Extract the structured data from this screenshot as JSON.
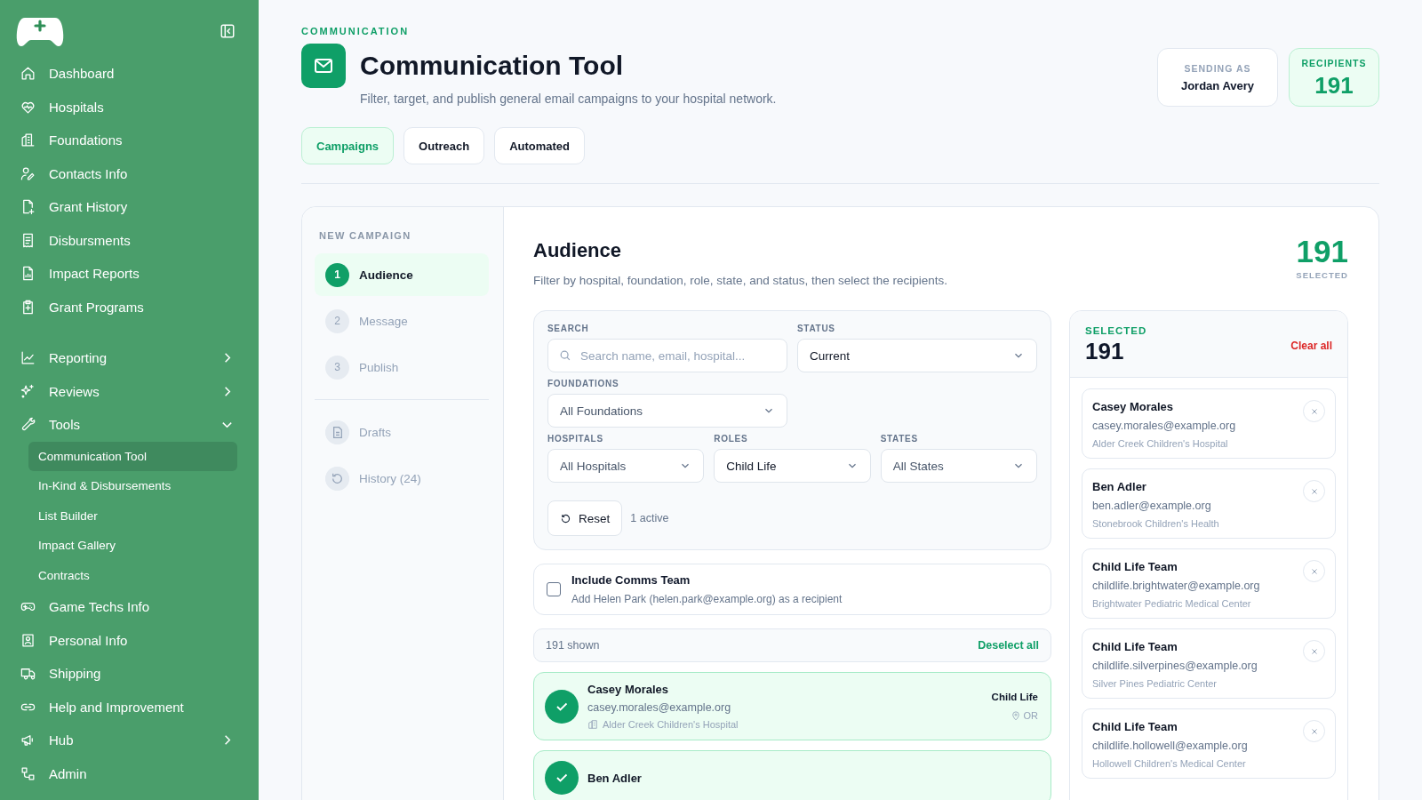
{
  "sidebar": {
    "sections": [
      {
        "items": [
          {
            "label": "Dashboard"
          },
          {
            "label": "Hospitals"
          },
          {
            "label": "Foundations"
          },
          {
            "label": "Contacts Info"
          },
          {
            "label": "Grant History"
          },
          {
            "label": "Disbursments"
          },
          {
            "label": "Impact Reports"
          },
          {
            "label": "Grant Programs"
          }
        ]
      },
      {
        "items": [
          {
            "label": "Reporting",
            "expanded": false
          },
          {
            "label": "Reviews",
            "expanded": false
          },
          {
            "label": "Tools",
            "expanded": true,
            "children": [
              {
                "label": "Communication Tool",
                "selected": true
              },
              {
                "label": "In-Kind & Disbursements",
                "selected": false
              },
              {
                "label": "List Builder",
                "selected": false
              },
              {
                "label": "Impact Gallery",
                "selected": false
              },
              {
                "label": "Contracts",
                "selected": false
              }
            ]
          },
          {
            "label": "Game Techs Info"
          },
          {
            "label": "Personal Info"
          },
          {
            "label": "Shipping"
          },
          {
            "label": "Help and Improvement"
          },
          {
            "label": "Hub",
            "expanded": false
          },
          {
            "label": "Admin"
          }
        ]
      }
    ]
  },
  "header": {
    "eyebrow": "COMMUNICATION",
    "title": "Communication Tool",
    "subtitle": "Filter, target, and publish general email campaigns to your hospital network.",
    "sending_as": {
      "label": "SENDING AS",
      "value": "Jordan Avery"
    },
    "recipients": {
      "label": "RECIPIENTS",
      "value": "191"
    }
  },
  "tabs": [
    {
      "label": "Campaigns",
      "selected": true
    },
    {
      "label": "Outreach",
      "selected": false
    },
    {
      "label": "Automated",
      "selected": false
    }
  ],
  "campaign_nav": {
    "title": "NEW CAMPAIGN",
    "steps": [
      {
        "number": "1",
        "label": "Audience",
        "selected": true
      },
      {
        "number": "2",
        "label": "Message",
        "selected": false
      },
      {
        "number": "3",
        "label": "Publish",
        "selected": false
      }
    ],
    "links": [
      {
        "label": "Drafts"
      },
      {
        "label": "History (24)"
      }
    ]
  },
  "audience": {
    "title": "Audience",
    "description": "Filter by hospital, foundation, role, state, and status, then select the recipients.",
    "count": "191",
    "count_label": "SELECTED",
    "filters": {
      "search": {
        "label": "SEARCH",
        "placeholder": "Search name, email, hospital..."
      },
      "status": {
        "label": "STATUS",
        "value": "Current"
      },
      "foundations": {
        "label": "FOUNDATIONS",
        "value": "All Foundations"
      },
      "hospitals": {
        "label": "HOSPITALS",
        "value": "All Hospitals"
      },
      "roles": {
        "label": "ROLES",
        "value": "Child Life"
      },
      "states": {
        "label": "STATES",
        "value": "All States"
      },
      "reset": "Reset",
      "active": "1 active"
    },
    "comms_team": {
      "checked": false,
      "title": "Include Comms Team",
      "description": "Add Helen Park (helen.park@example.org) as a recipient"
    },
    "list_bar": {
      "shown": "191 shown",
      "action": "Deselect all"
    },
    "rows": [
      {
        "name": "Casey Morales",
        "email": "casey.morales@example.org",
        "hospital": "Alder Creek Children's Hospital",
        "role": "Child Life",
        "state": "OR",
        "selected": true
      },
      {
        "name": "Ben Adler",
        "selected": true
      }
    ]
  },
  "selected_panel": {
    "label": "SELECTED",
    "count": "191",
    "clear": "Clear all",
    "items": [
      {
        "name": "Casey Morales",
        "email": "casey.morales@example.org",
        "hospital": "Alder Creek Children's Hospital"
      },
      {
        "name": "Ben Adler",
        "email": "ben.adler@example.org",
        "hospital": "Stonebrook Children's Health"
      },
      {
        "name": "Child Life Team",
        "email": "childlife.brightwater@example.org",
        "hospital": "Brightwater Pediatric Medical Center"
      },
      {
        "name": "Child Life Team",
        "email": "childlife.silverpines@example.org",
        "hospital": "Silver Pines Pediatric Center"
      },
      {
        "name": "Child Life Team",
        "email": "childlife.hollowell@example.org",
        "hospital": "Hollowell Children's Medical Center"
      }
    ]
  }
}
